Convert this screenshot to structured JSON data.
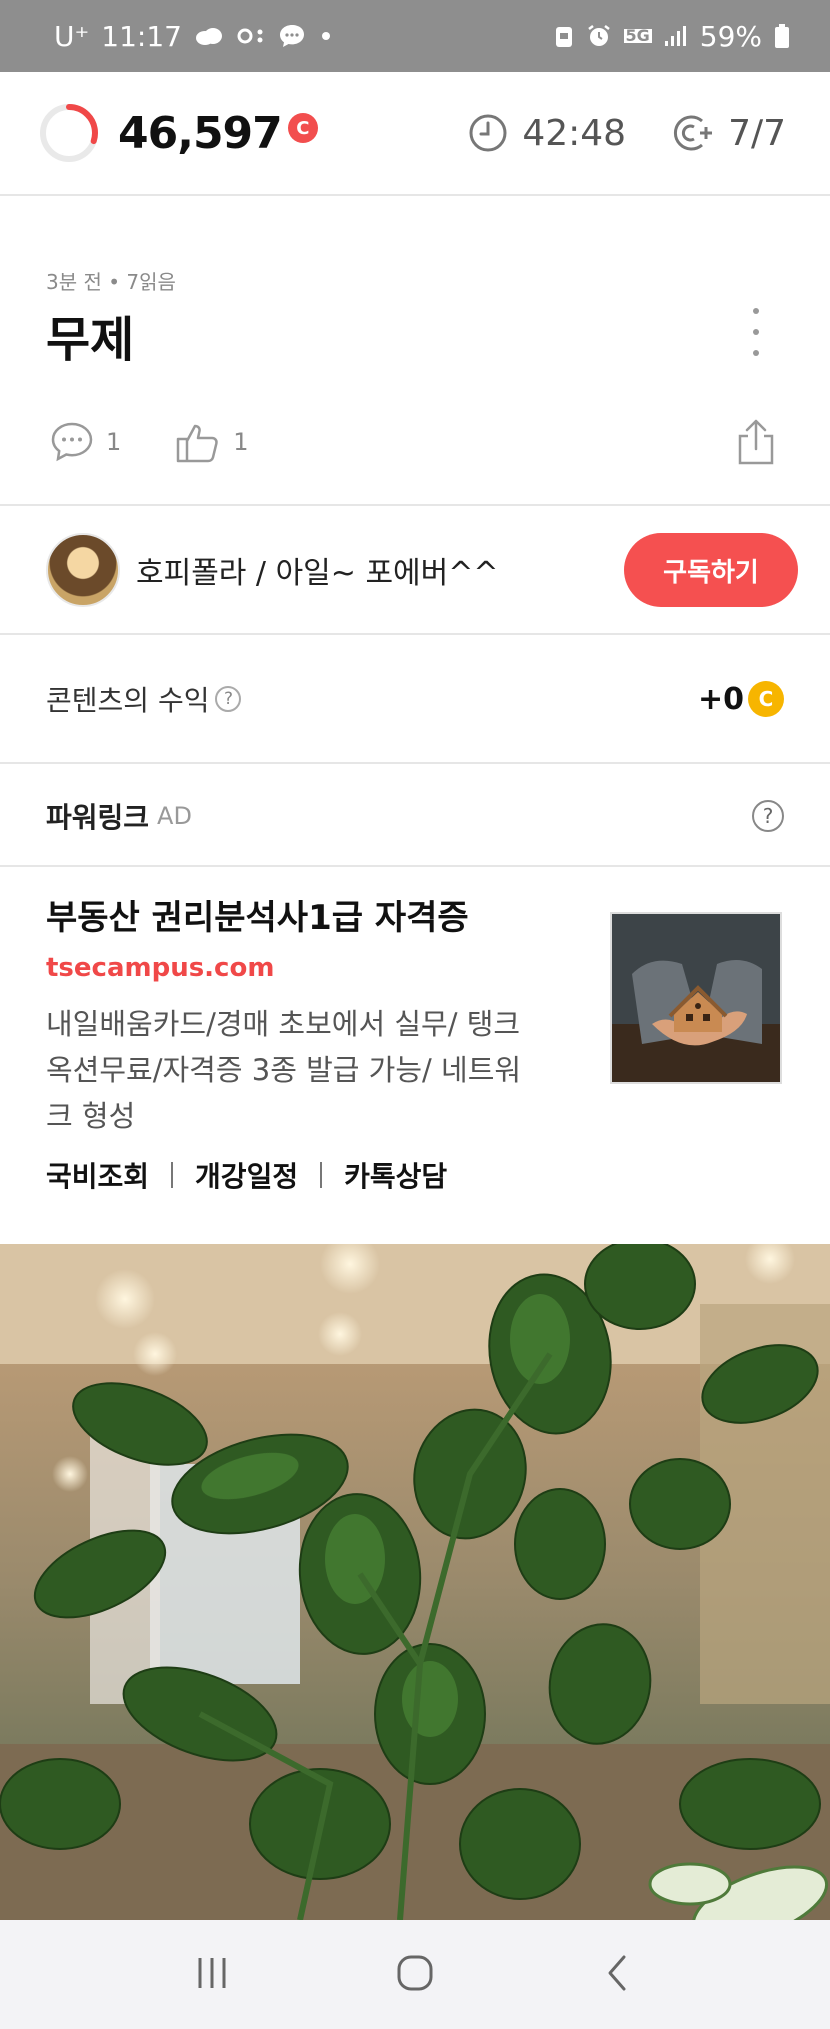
{
  "status_bar": {
    "carrier": "U⁺",
    "time": "11:17",
    "battery": "59%",
    "network": "5G"
  },
  "top_bar": {
    "points": "46,597",
    "coin_symbol": "C",
    "timer": "42:48",
    "count": "7/7",
    "ring_progress": 0.3
  },
  "post": {
    "meta": "3분 전 • 7읽음",
    "title": "무제",
    "comment_count": "1",
    "like_count": "1"
  },
  "author": {
    "name": "호피폴라 / 아일~ 포에버^^",
    "subscribe_label": "구독하기"
  },
  "revenue": {
    "label": "콘텐츠의 수익",
    "help": "?",
    "value": "+0",
    "coin_symbol": "C"
  },
  "powerlink": {
    "title": "파워링크",
    "ad_tag": "AD",
    "help": "?"
  },
  "ad": {
    "title": "부동산 권리분석사1급 자격증",
    "url": "tsecampus.com",
    "description": "내일배움카드/경매 초보에서 실무/ 탱크옥션무료/자격증 3종 발급 가능/ 네트워크 형성",
    "links": [
      "국비조회",
      "개강일정",
      "카톡상담"
    ]
  },
  "colors": {
    "accent_red": "#f55050",
    "coin_yellow": "#f7b500",
    "status_bar": "#8e8e8e"
  }
}
